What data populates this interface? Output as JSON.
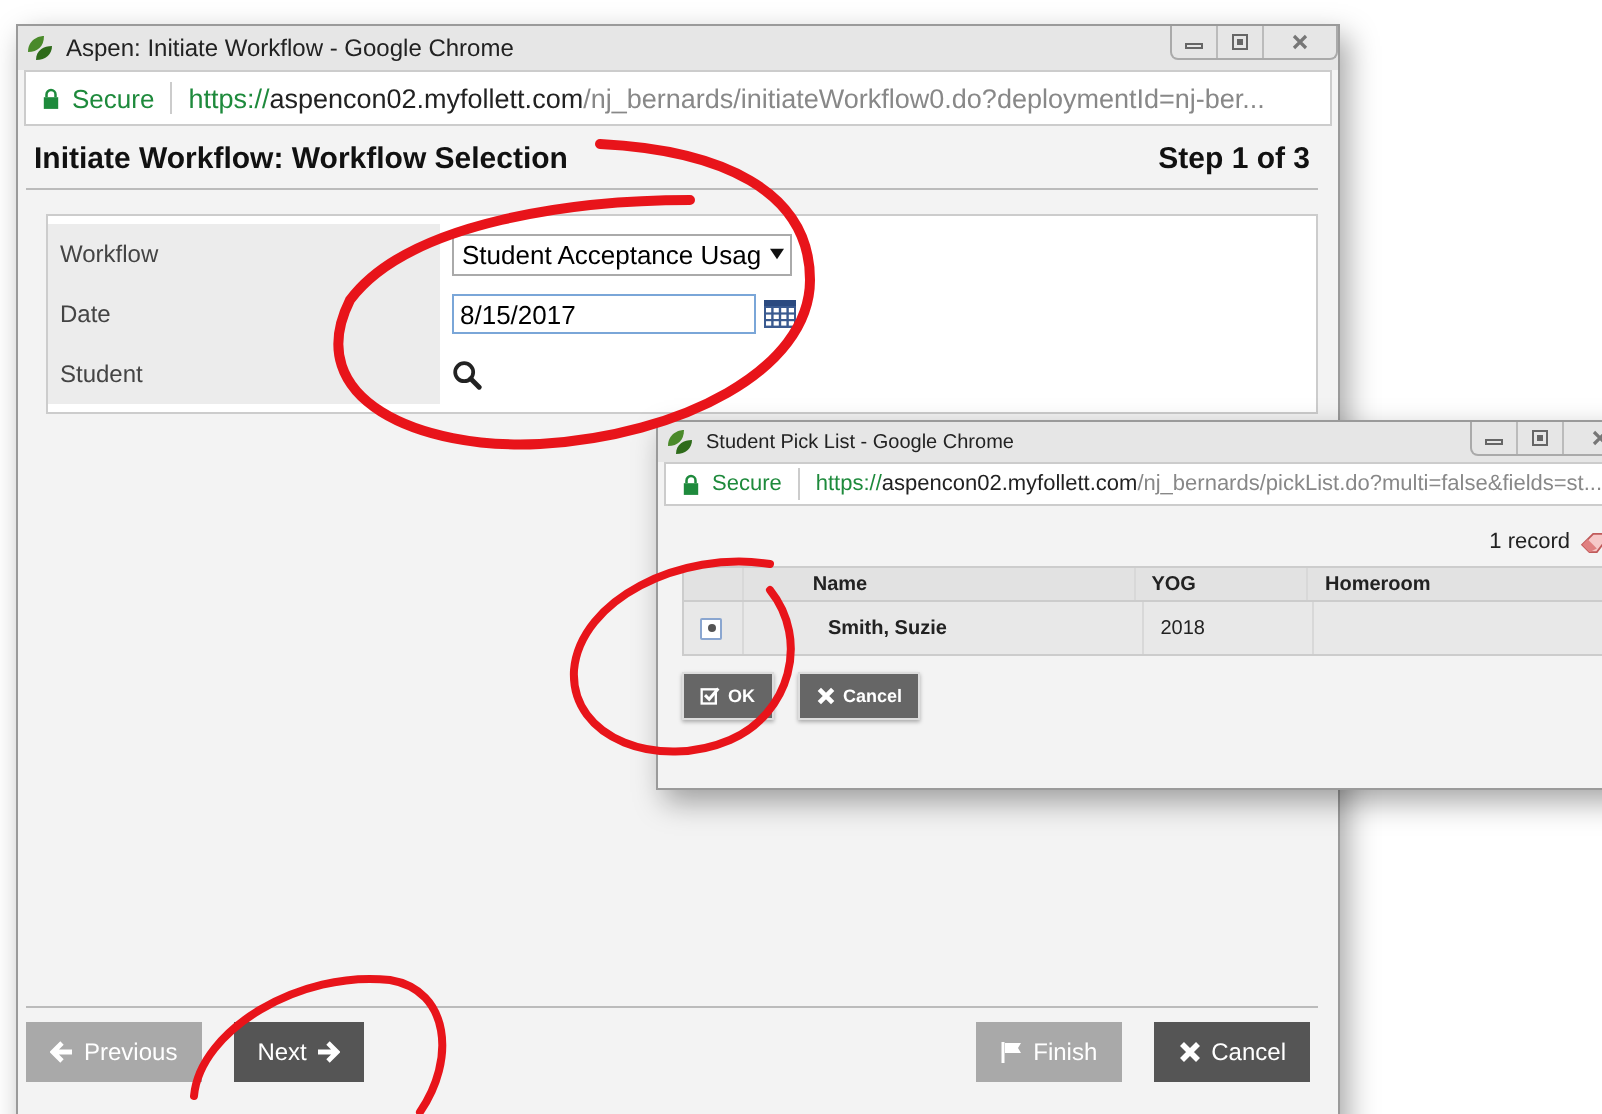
{
  "main_window": {
    "title": "Aspen: Initiate Workflow - Google Chrome",
    "secure_label": "Secure",
    "url_scheme": "https://",
    "url_host": "aspencon02.myfollett.com",
    "url_path": "/nj_bernards/initiateWorkflow0.do?deploymentId=nj-ber...",
    "page_title": "Initiate Workflow: Workflow Selection",
    "step": "Step 1 of 3",
    "form": [
      {
        "label": "Workflow",
        "kind": "select",
        "value": "Student Acceptance Usag"
      },
      {
        "label": "Date",
        "kind": "date",
        "value": "8/15/2017"
      },
      {
        "label": "Student",
        "kind": "lookup"
      }
    ],
    "buttons": [
      {
        "label": "Previous",
        "kind": "back",
        "disabled": true
      },
      {
        "label": "Next",
        "kind": "next",
        "disabled": false
      },
      {
        "label": "Finish",
        "kind": "finish",
        "disabled": true
      },
      {
        "label": "Cancel",
        "kind": "cancel",
        "disabled": false
      }
    ]
  },
  "picklist_window": {
    "title": "Student Pick List - Google Chrome",
    "secure_label": "Secure",
    "url_scheme": "https://",
    "url_host": "aspencon02.myfollett.com",
    "url_path": "/nj_bernards/pickList.do?multi=false&fields=st...",
    "record_count": "1 record",
    "columns": [
      "Name",
      "YOG",
      "Homeroom"
    ],
    "rows": [
      {
        "selected": true,
        "name": "Smith, Suzie",
        "yog": "2018"
      }
    ],
    "buttons": [
      {
        "label": "OK",
        "kind": "ok"
      },
      {
        "label": "Cancel",
        "kind": "cancel"
      }
    ]
  }
}
